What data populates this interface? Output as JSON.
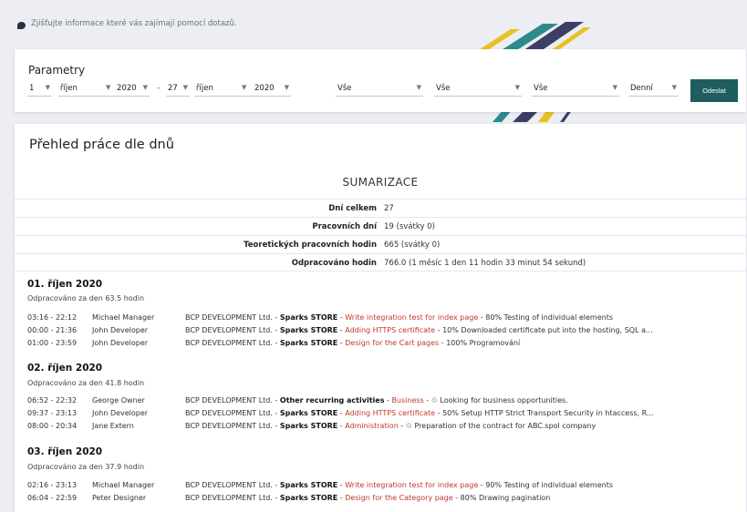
{
  "info_text": "Zjišťujte informace které vás zajímají pomocí dotazů.",
  "params": {
    "title": "Parametry",
    "from_day": "1",
    "from_month": "říjen",
    "from_year": "2020",
    "to_day": "27",
    "to_month": "říjen",
    "to_year": "2020",
    "range_separator": "-",
    "filter1": "Vše",
    "filter2": "Vše",
    "filter3": "Vše",
    "granularity": "Denní",
    "submit": "Odeslat"
  },
  "report": {
    "title": "Přehled práce dle dnů",
    "summary_title": "SUMARIZACE",
    "summary": [
      {
        "label": "Dní celkem",
        "value": "27"
      },
      {
        "label": "Pracovních dní",
        "value": "19 (svátky 0)"
      },
      {
        "label": "Teoretických pracovních hodin",
        "value": "665 (svátky 0)"
      },
      {
        "label": "Odpracováno hodin",
        "value": "766.0 (1 měsíc 1 den 11 hodin 33 minut 54 sekund)"
      }
    ],
    "days": [
      {
        "date": "01. říjen 2020",
        "worked": "Odpracováno za den 63.5 hodin",
        "entries": [
          {
            "time": "03:16 - 22:12",
            "user": "Michael Manager",
            "company": "BCP DEVELOPMENT Ltd. -",
            "project": "Sparks STORE",
            "sep": "-",
            "task": "Write integration test for index page",
            "rest": "- 80%   Testing of individual elements"
          },
          {
            "time": "00:00 - 21:36",
            "user": "John Developer",
            "company": "BCP DEVELOPMENT Ltd. -",
            "project": "Sparks STORE",
            "sep": "-",
            "task": "Adding HTTPS certificate",
            "rest": "- 10%   Downloaded certificate put into the hosting, SQL a..."
          },
          {
            "time": "01:00 - 23:59",
            "user": "John Developer",
            "company": "BCP DEVELOPMENT Ltd. -",
            "project": "Sparks STORE",
            "sep": "-",
            "task": "Design for the Cart pages",
            "rest": "- 100%   Programování"
          }
        ]
      },
      {
        "date": "02. říjen 2020",
        "worked": "Odpracováno za den 41.8 hodin",
        "entries": [
          {
            "time": "06:52 - 22:32",
            "user": "George Owner",
            "company": "BCP DEVELOPMENT Ltd. -",
            "project": "Other recurring activities",
            "sep": "-",
            "task": "Business",
            "rest": "- ♲ Looking for business opportunities."
          },
          {
            "time": "09:37 - 23:13",
            "user": "John Developer",
            "company": "BCP DEVELOPMENT Ltd. -",
            "project": "Sparks STORE",
            "sep": "-",
            "task": "Adding HTTPS certificate",
            "rest": "- 50%   Setup HTTP Strict Transport Security in htaccess, R..."
          },
          {
            "time": "08:00 - 20:34",
            "user": "Jane Extern",
            "company": "BCP DEVELOPMENT Ltd. -",
            "project": "Sparks STORE",
            "sep": "-",
            "task": "Administration",
            "rest": "- ♲ Preparation of the contract for ABC.spol company"
          }
        ]
      },
      {
        "date": "03. říjen 2020",
        "worked": "Odpracováno za den 37.9 hodin",
        "entries": [
          {
            "time": "02:16 - 23:13",
            "user": "Michael Manager",
            "company": "BCP DEVELOPMENT Ltd. -",
            "project": "Sparks STORE",
            "sep": "-",
            "task": "Write integration test for index page",
            "rest": "- 90%   Testing of individual elements"
          },
          {
            "time": "06:04 - 22:59",
            "user": "Peter Designer",
            "company": "BCP DEVELOPMENT Ltd. -",
            "project": "Sparks STORE",
            "sep": "-",
            "task": "Design for the Category page",
            "rest": "- 80%   Drawing pagination"
          }
        ]
      }
    ]
  },
  "colors": {
    "accent": "#1f5d5e",
    "task": "#c0392b",
    "background": "#eceef3"
  },
  "icons": {
    "info": "chat-bubble-icon",
    "dropdown": "caret-down-icon",
    "recurring": "recycle-icon"
  }
}
